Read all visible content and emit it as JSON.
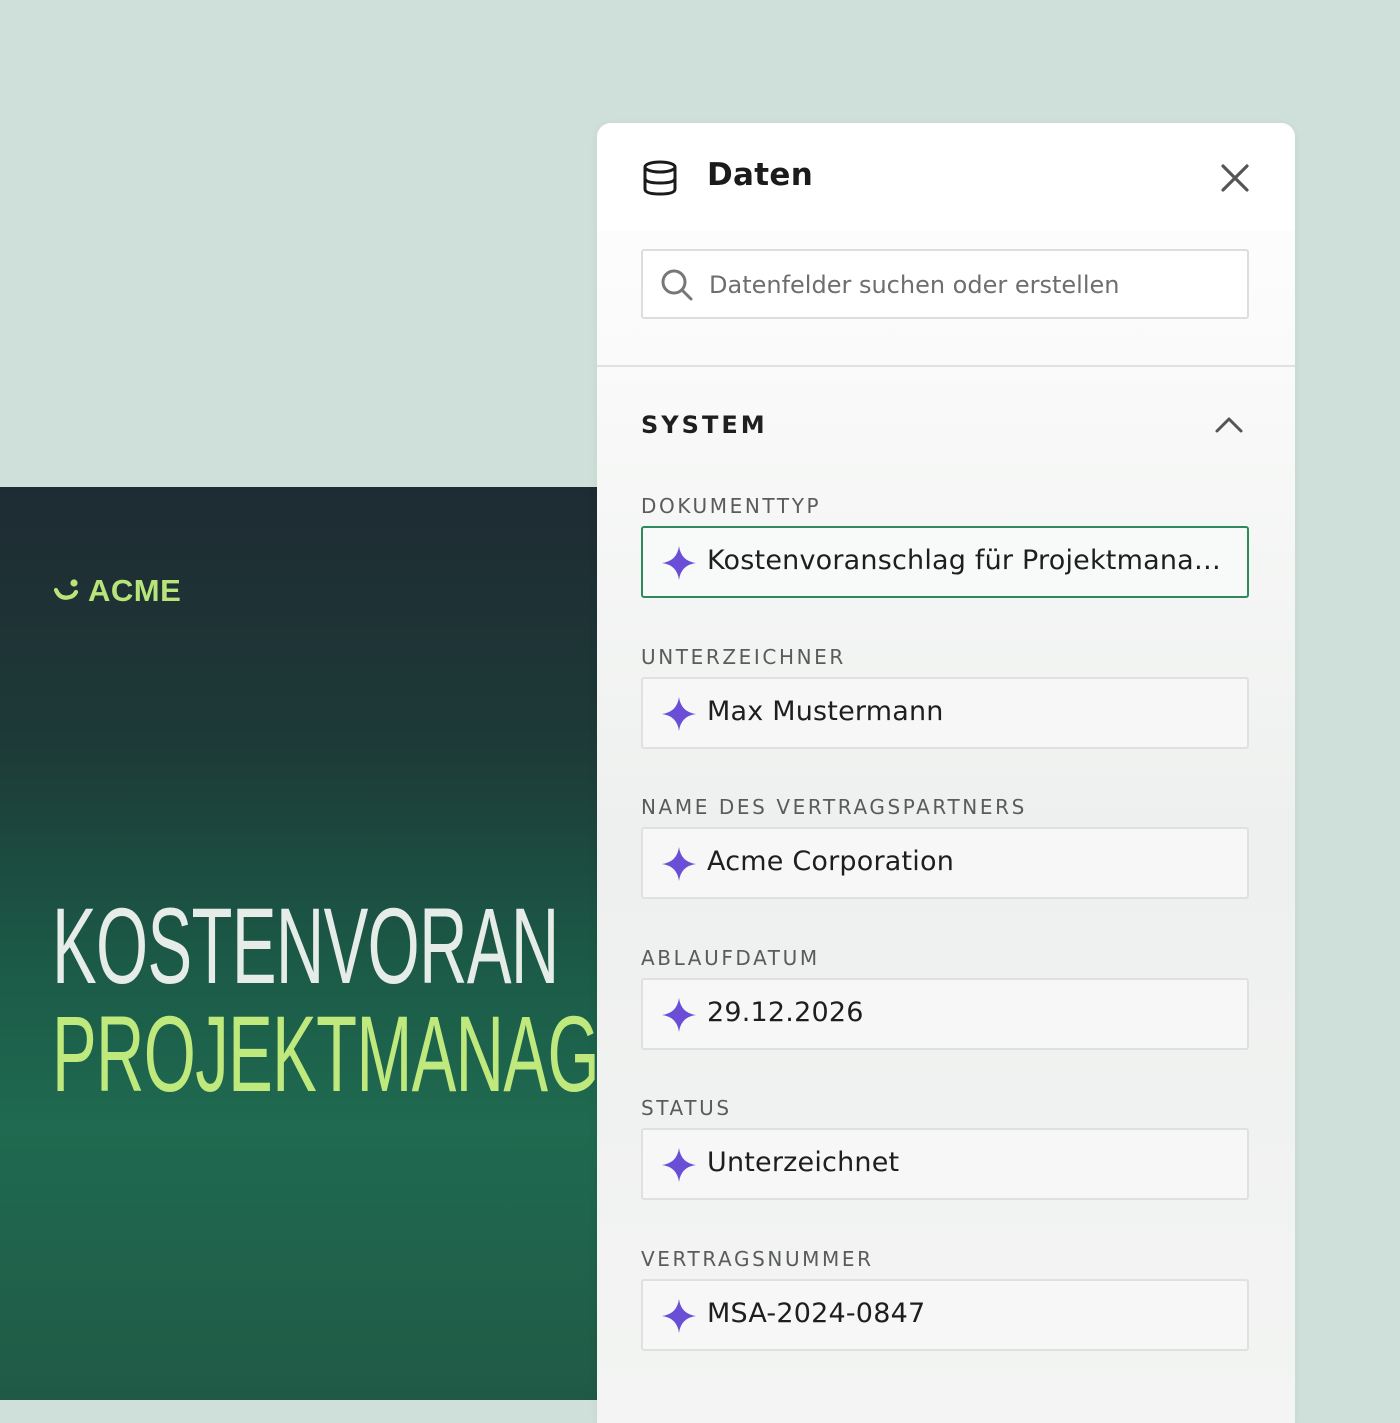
{
  "document": {
    "logo_text": "ACME",
    "title_line1": "KOSTENVORAN",
    "title_line2": "PROJEKTMANAG"
  },
  "panel": {
    "title": "Daten",
    "header_icon": "database-icon",
    "close_icon": "close-icon",
    "search": {
      "placeholder": "Datenfelder suchen oder erstellen",
      "value": "",
      "icon": "search-icon"
    },
    "section": {
      "title": "SYSTEM",
      "toggle_icon": "chevron-up-icon",
      "fields": [
        {
          "label": "DOKUMENTTYP",
          "value": "Kostenvoranschlag für Projektmanagement"
        },
        {
          "label": "UNTERZEICHNER",
          "value": "Max Mustermann"
        },
        {
          "label": "NAME DES VERTRAGSPARTNERS",
          "value": "Acme Corporation"
        },
        {
          "label": "ABLAUFDATUM",
          "value": "29.12.2026"
        },
        {
          "label": "STATUS",
          "value": "Unterzeichnet"
        },
        {
          "label": "VERTRAGSNUMMER",
          "value": "MSA-2024-0847"
        }
      ],
      "field_icon": "sparkle-icon"
    }
  },
  "colors": {
    "background": "#cfe0da",
    "accent_sparkle": "#6a4fd6",
    "active_border": "#2f8a5b",
    "logo_green": "#b9e47a"
  }
}
